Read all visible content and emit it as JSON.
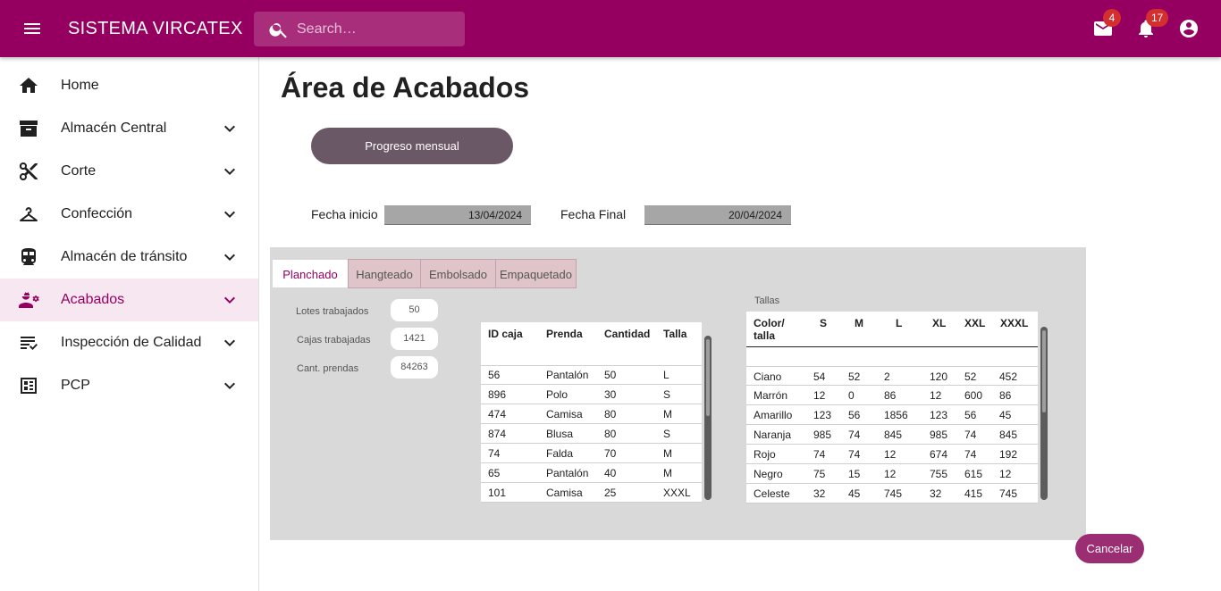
{
  "header": {
    "title": "SISTEMA VIRCATEX",
    "search_placeholder": "Search…",
    "mail_count": "4",
    "notif_count": "17",
    "brand_color": "#950060"
  },
  "sidebar": {
    "items": [
      {
        "label": "Home",
        "icon": "home-icon"
      },
      {
        "label": "Almacén Central",
        "icon": "archive-icon"
      },
      {
        "label": "Corte",
        "icon": "scissors-icon"
      },
      {
        "label": "Confección",
        "icon": "hanger-icon"
      },
      {
        "label": "Almacén de tránsito",
        "icon": "train-icon"
      },
      {
        "label": "Acabados",
        "icon": "engineering-icon",
        "active": true
      },
      {
        "label": "Inspección de Calidad",
        "icon": "checklist-icon"
      },
      {
        "label": "PCP",
        "icon": "dashboard-icon"
      }
    ]
  },
  "main": {
    "title": "Área de Acabados",
    "progress_button": "Progreso mensual",
    "fecha_inicio_label": "Fecha inicio",
    "fecha_inicio_value": "13/04/2024",
    "fecha_final_label": "Fecha Final",
    "fecha_final_value": "20/04/2024",
    "cancel_button": "Cancelar"
  },
  "tabs": [
    "Planchado",
    "Hangteado",
    "Embolsado",
    "Empaquetado"
  ],
  "stats": [
    {
      "label": "Lotes trabajados",
      "value": "50"
    },
    {
      "label": "Cajas trabajadas",
      "value": "1421"
    },
    {
      "label": "Cant. prendas",
      "value": "84263"
    }
  ],
  "boxes_table": {
    "columns": [
      "ID caja",
      "Prenda",
      "Cantidad",
      "Talla"
    ],
    "rows": [
      [
        "56",
        "Pantalón",
        "50",
        "L"
      ],
      [
        "896",
        "Polo",
        "30",
        "S"
      ],
      [
        "474",
        "Camisa",
        "80",
        "M"
      ],
      [
        "874",
        "Blusa",
        "80",
        "S"
      ],
      [
        "74",
        "Falda",
        "70",
        "M"
      ],
      [
        "65",
        "Pantalón",
        "40",
        "M"
      ],
      [
        "101",
        "Camisa",
        "25",
        "XXXL"
      ]
    ]
  },
  "sizes_table": {
    "caption": "Tallas",
    "corner_line1": "Color/",
    "corner_line2": "talla",
    "columns": [
      "S",
      "M",
      "L",
      "XL",
      "XXL",
      "XXXL"
    ],
    "rows": [
      [
        "Ciano",
        "54",
        "52",
        "2",
        "120",
        "52",
        "452"
      ],
      [
        "Marrón",
        "12",
        "0",
        "86",
        "12",
        "600",
        "86"
      ],
      [
        "Amarillo",
        "123",
        "56",
        "1856",
        "123",
        "56",
        "45"
      ],
      [
        "Naranja",
        "985",
        "74",
        "845",
        "985",
        "74",
        "845"
      ],
      [
        "Rojo",
        "74",
        "74",
        "12",
        "674",
        "74",
        "192"
      ],
      [
        "Negro",
        "75",
        "15",
        "12",
        "755",
        "615",
        "12"
      ],
      [
        "Celeste",
        "32",
        "45",
        "745",
        "32",
        "415",
        "745"
      ]
    ]
  }
}
